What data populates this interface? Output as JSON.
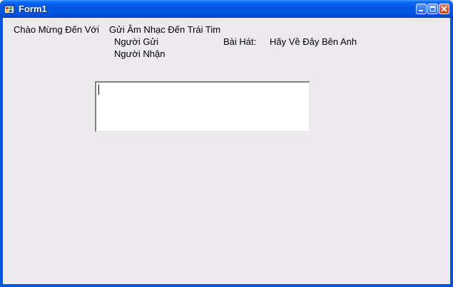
{
  "window": {
    "title": "Form1",
    "icon": "app-window-icon",
    "controls": [
      "minimize-icon",
      "maximize-icon",
      "close-icon"
    ]
  },
  "form": {
    "welcome_label": "Chào Mừng Đến Với",
    "heading_label": "Gửi Âm Nhạc Đến Trái Tim",
    "sender_label": "Người Gửi",
    "receiver_label": "Người Nhận",
    "song_caption": "Bài Hát:",
    "song_value": "Hãy Về Đây Bên Anh",
    "message_box_value": ""
  },
  "colors": {
    "titlebar": "#0054e3",
    "client_background": "#ece9ef",
    "close_button": "#c9411f"
  }
}
